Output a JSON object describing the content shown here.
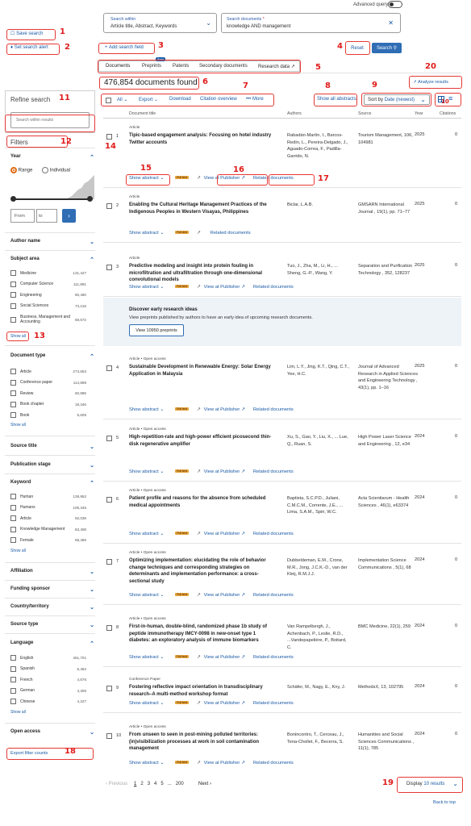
{
  "header": {
    "advanced_query": "Advanced query"
  },
  "search": {
    "within_label": "Search within",
    "within_value": "Article title, Abstract, Keywords",
    "docs_label": "Search documents",
    "docs_value": "knowledge AND management",
    "add_field": "Add search field",
    "reset": "Reset",
    "search": "Search"
  },
  "left_links": {
    "save_search": "Save search",
    "set_alert": "Set search alert"
  },
  "tabs": {
    "documents": "Documents",
    "preprints": "Preprints",
    "beta": "Beta",
    "patents": "Patents",
    "secondary": "Secondary documents",
    "research_data": "Research data"
  },
  "results": {
    "count": "476,854 documents found",
    "analyze": "Analyze results"
  },
  "toolbar": {
    "all": "All",
    "export": "Export",
    "download": "Download",
    "citation_overview": "Citation overview",
    "more": "More",
    "show_all_abstracts": "Show all abstracts",
    "sort_by": "Sort by",
    "sort_value": "Date (newest)"
  },
  "columns": {
    "title": "Document title",
    "authors": "Authors",
    "source": "Source",
    "year": "Year",
    "citations": "Citations"
  },
  "refine": {
    "title": "Refine search",
    "placeholder": "Search within results",
    "filters": "Filters"
  },
  "year": {
    "title": "Year",
    "range": "Range",
    "individual": "Individual",
    "from": "From",
    "to": "to"
  },
  "facets": {
    "author_name": "Author name",
    "subject_area": {
      "title": "Subject area",
      "items": [
        {
          "label": "Medicine",
          "count": "131,427"
        },
        {
          "label": "Computer Science",
          "count": "111,891"
        },
        {
          "label": "Engineering",
          "count": "80,460"
        },
        {
          "label": "Social Sciences",
          "count": "73,216"
        },
        {
          "label": "Business, Management and Accounting",
          "count": "68,672"
        }
      ],
      "show_all": "Show all"
    },
    "document_type": {
      "title": "Document type",
      "items": [
        {
          "label": "Article",
          "count": "274,553"
        },
        {
          "label": "Conference paper",
          "count": "114,898"
        },
        {
          "label": "Review",
          "count": "50,895"
        },
        {
          "label": "Book chapter",
          "count": "18,346"
        },
        {
          "label": "Book",
          "count": "5,605"
        }
      ],
      "show_all": "Show all"
    },
    "source_title": "Source title",
    "publication_stage": "Publication stage",
    "keyword": {
      "title": "Keyword",
      "items": [
        {
          "label": "Human",
          "count": "139,952"
        },
        {
          "label": "Humans",
          "count": "106,346"
        },
        {
          "label": "Article",
          "count": "92,039"
        },
        {
          "label": "Knowledge Management",
          "count": "83,408"
        },
        {
          "label": "Female",
          "count": "58,456"
        }
      ],
      "show_all": "Show all"
    },
    "affiliation": "Affiliation",
    "funding_sponsor": "Funding sponsor",
    "country": "Country/territory",
    "source_type": "Source type",
    "language": {
      "title": "Language",
      "items": [
        {
          "label": "English",
          "count": "451,701"
        },
        {
          "label": "Spanish",
          "count": "6,462"
        },
        {
          "label": "French",
          "count": "4,676"
        },
        {
          "label": "German",
          "count": "4,306"
        },
        {
          "label": "Chinese",
          "count": "4,227"
        }
      ],
      "show_all": "Show all"
    },
    "open_access": "Open access",
    "export_filter": "Export filter counts"
  },
  "actions": {
    "show_abstract": "Show abstract",
    "view_publisher": "View at Publisher",
    "related": "Related documents",
    "fulltext": "Full text"
  },
  "preprint_banner": {
    "title": "Discover early research ideas",
    "text": "View preprints published by authors to have an early idea of upcoming research documents.",
    "button": "View 10950 preprints"
  },
  "rows": [
    {
      "n": "1",
      "type": "Article",
      "title": "Tipic-based engagement analysis: Focusing on hotel industry Twitter accounts",
      "authors": "Rabadán-Martín, I., Barcos-Redín, L., Pereira-Delgado, J., Aguado-Correa, F., Padilla-Garrido, N.",
      "source": "Tourism Management, 106, 104981",
      "year": "2025",
      "cit": "0"
    },
    {
      "n": "2",
      "type": "Article",
      "title": "Enabling the Cultural Heritage Management Practices of the Indigenous Peoples in Western Visayas, Philippines",
      "authors": "Biclar, L.A.B.",
      "source": "GMSARN International Journal , 19(1), pp. 71–77",
      "year": "2025",
      "cit": "0"
    },
    {
      "n": "3",
      "type": "Article",
      "title": "Predictive modeling and insight into protein fouling in microfiltration and ultrafiltration through one-dimensional convolutional models",
      "authors": "Tuo, J., Zha, M., Li, H., ... Sheng, G.-P., Wang, Y.",
      "source": "Separation and Purification Technology , 352, 128237",
      "year": "2025",
      "cit": "0"
    },
    {
      "n": "4",
      "type": "Article • Open access",
      "title": "Sustainable Development in Renewable Energy: Solar Energy Application in Malaysia",
      "authors": "Lim, L.Y., Jing, K.T., Qing, C.T., Yee, H.C.",
      "source": "Journal of Advanced Research in Applied Sciences and Engineering Technology , 43(1), pp. 1–16",
      "year": "2025",
      "cit": "0"
    },
    {
      "n": "5",
      "type": "Article • Open access",
      "title": "High-repetition-rate and high-power efficient picosecond thin-disk regenerative amplifier",
      "authors": "Xu, S., Gao, Y., Liu, X., ... Lue, Q., Ruan, S.",
      "source": "High Power Laser Science and Engineering , 12, e34",
      "year": "2024",
      "cit": "0"
    },
    {
      "n": "6",
      "type": "Article • Open access",
      "title": "Patient profile and reasons for the absence from scheduled medical appointments",
      "authors": "Baptista, S.C.P.D., Juliani, C.M.C.M., Corrente, J.E., ... Lima, S.A.M., Spiri, W.C.",
      "source": "Acta Scientiarum - Health Sciences , 46(1), e63374",
      "year": "2024",
      "cit": "0"
    },
    {
      "n": "7",
      "type": "Article • Open access",
      "title": "Optimizing implementation: elucidating the role of behavior change techniques and corresponding strategies on determinants and implementation performance: a cross-sectional study",
      "authors": "Dubbeldeman, E.M., Crone, M.R., Jong, J.C.K.-D., van der Kleij, R.M.J.J.",
      "source": "Implementation Science Communications , 5(1), 68",
      "year": "2024",
      "cit": "0"
    },
    {
      "n": "8",
      "type": "Article • Open access",
      "title": "First-in-human, double-blind, randomized phase 1b study of peptide immunotherapy IMCY-0098 in new-onset type 1 diabetes: an exploratory analysis of immune biomarkers",
      "authors": "Van Rampelbergh, J., Achenbach, P., Leslie, R.D., ...Vandepapelière, P., Boitard, C.",
      "source": "BMC Medicine, 22(1), 259",
      "year": "2024",
      "cit": "0"
    },
    {
      "n": "9",
      "type": "Conference Paper",
      "title": "Fostering reflective impact orientation in transdisciplinary research–A multi-method workshop format",
      "authors": "Schäfer, M., Nagy, E., Kny, J.",
      "source": "MethodsX, 13, 102795",
      "year": "2024",
      "cit": "0"
    },
    {
      "n": "10",
      "type": "Article • Open access",
      "title": "From unseen to seen in post-mining polluted territories: (in)visibilization processes at work in soil contamination management",
      "authors": "Bonincontro, T., Cerceau, J., Tena-Chollet, F., Becerra, S.",
      "source": "Humanities and Social Sciences Communications , 11(1), 785",
      "year": "2024",
      "cit": "0"
    }
  ],
  "pagination": {
    "previous": "Previous",
    "pages": [
      "1",
      "2",
      "3",
      "4",
      "5",
      "...",
      "200"
    ],
    "next": "Next",
    "display": "Display",
    "display_value": "10 results",
    "back_to_top": "Back to top"
  },
  "annotations": [
    "1",
    "2",
    "3",
    "4",
    "5",
    "6",
    "7",
    "8",
    "9",
    "10",
    "11",
    "12",
    "13",
    "14",
    "15",
    "16",
    "17",
    "18",
    "19",
    "20",
    "21"
  ]
}
